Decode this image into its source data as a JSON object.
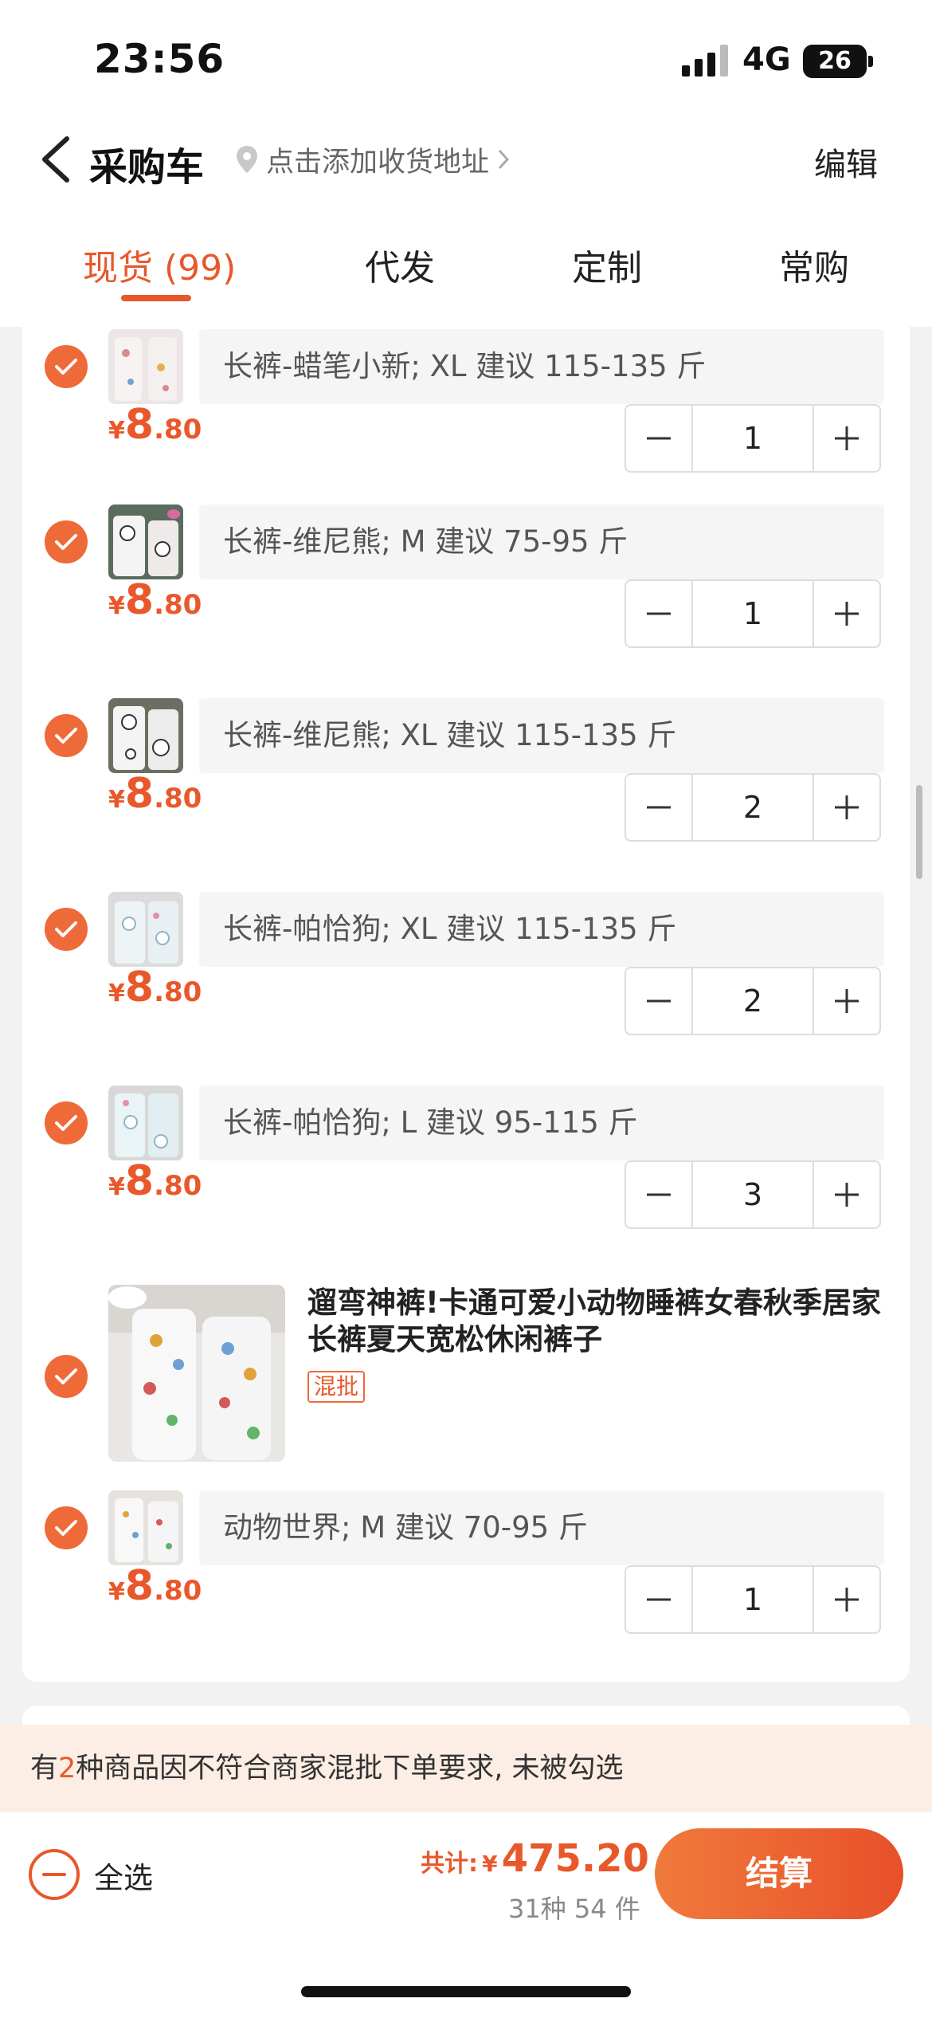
{
  "status_bar": {
    "time": "23:56",
    "network": "4G",
    "battery": "26"
  },
  "header": {
    "title": "采购车",
    "address_prompt": "点击添加收货地址",
    "edit_label": "编辑"
  },
  "tabs": [
    {
      "label": "现货 (99)",
      "active": true
    },
    {
      "label": "代发",
      "active": false
    },
    {
      "label": "定制",
      "active": false
    },
    {
      "label": "常购",
      "active": false
    }
  ],
  "cart_items": [
    {
      "spec": "长裤-蜡笔小新; XL 建议 115-135 斤",
      "price_symbol": "¥",
      "price_int": "8",
      "price_dec": ".80",
      "quantity": "1"
    },
    {
      "spec": "长裤-维尼熊; M 建议 75-95 斤",
      "price_symbol": "¥",
      "price_int": "8",
      "price_dec": ".80",
      "quantity": "1"
    },
    {
      "spec": "长裤-维尼熊; XL 建议 115-135 斤",
      "price_symbol": "¥",
      "price_int": "8",
      "price_dec": ".80",
      "quantity": "2"
    },
    {
      "spec": "长裤-帕恰狗; XL 建议 115-135 斤",
      "price_symbol": "¥",
      "price_int": "8",
      "price_dec": ".80",
      "quantity": "2"
    },
    {
      "spec": "长裤-帕恰狗; L 建议 95-115 斤",
      "price_symbol": "¥",
      "price_int": "8",
      "price_dec": ".80",
      "quantity": "3"
    }
  ],
  "product": {
    "title": "遛弯神裤!卡通可爱小动物睡裤女春秋季居家长裤夏天宽松休闲裤子",
    "tag": "混批"
  },
  "product_item": {
    "spec": "动物世界; M 建议 70-95 斤",
    "price_symbol": "¥",
    "price_int": "8",
    "price_dec": ".80",
    "quantity": "1"
  },
  "notice": {
    "prefix": "有",
    "count": "2",
    "suffix": "种商品因不符合商家混批下单要求, 未被勾选"
  },
  "footer": {
    "select_all_label": "全选",
    "total_label": "共计:",
    "total_symbol": "¥",
    "total_amount": "475.20",
    "item_count": "31种 54 件",
    "checkout_label": "结算"
  },
  "colors": {
    "accent": "#e8582b",
    "notice_bg": "#fdeee5",
    "spec_bg": "#f5f5f5"
  },
  "icons": [
    "back-chevron-icon",
    "location-pin-icon",
    "check-circle-icon",
    "minus-icon",
    "plus-icon"
  ]
}
